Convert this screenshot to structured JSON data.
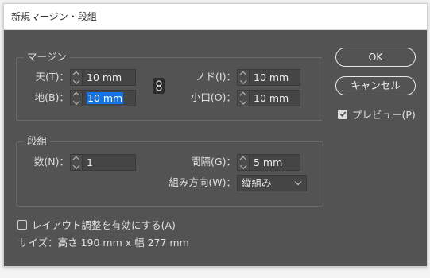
{
  "window": {
    "title": "新規マージン・段組"
  },
  "margins": {
    "group_title": "マージン",
    "top": {
      "label": "天(T)：",
      "value": "10 mm"
    },
    "bottom": {
      "label": "地(B)：",
      "value": "10 mm"
    },
    "inside": {
      "label": "ノド(I)：",
      "value": "10 mm"
    },
    "outside": {
      "label": "小口(O)：",
      "value": "10 mm"
    },
    "link_icon": "chain-link-icon"
  },
  "columns": {
    "group_title": "段組",
    "number": {
      "label": "数(N)：",
      "value": "1"
    },
    "gutter": {
      "label": "間隔(G)：",
      "value": "5 mm"
    },
    "direction": {
      "label": "組み方向(W)：",
      "selected": "縦組み"
    }
  },
  "buttons": {
    "ok": "OK",
    "cancel": "キャンセル"
  },
  "preview": {
    "label": "プレビュー(P)",
    "checked": true
  },
  "adjust_layout": {
    "label": "レイアウト調整を有効にする(A)",
    "checked": false
  },
  "size_text": "サイズ：高さ 190 mm x 幅 277 mm",
  "colors": {
    "panel": "#535353",
    "accent": "#1473e6",
    "field": "#454545"
  }
}
